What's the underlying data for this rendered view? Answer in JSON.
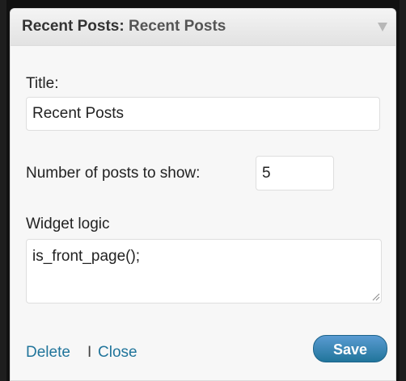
{
  "widget": {
    "header": {
      "title": "Recent Posts:",
      "subtitle": "Recent Posts"
    },
    "title_field": {
      "label": "Title:",
      "value": "Recent Posts"
    },
    "count_field": {
      "label": "Number of posts to show:",
      "value": "5"
    },
    "logic_field": {
      "label": "Widget logic",
      "value": "is_front_page();"
    },
    "footer": {
      "delete_label": "Delete",
      "separator": "I",
      "close_label": "Close",
      "save_label": "Save"
    }
  },
  "colors": {
    "link": "#21759b",
    "save_button": "#21759b",
    "panel_bg": "#f7f7f7",
    "backdrop": "#1e1e1e"
  }
}
